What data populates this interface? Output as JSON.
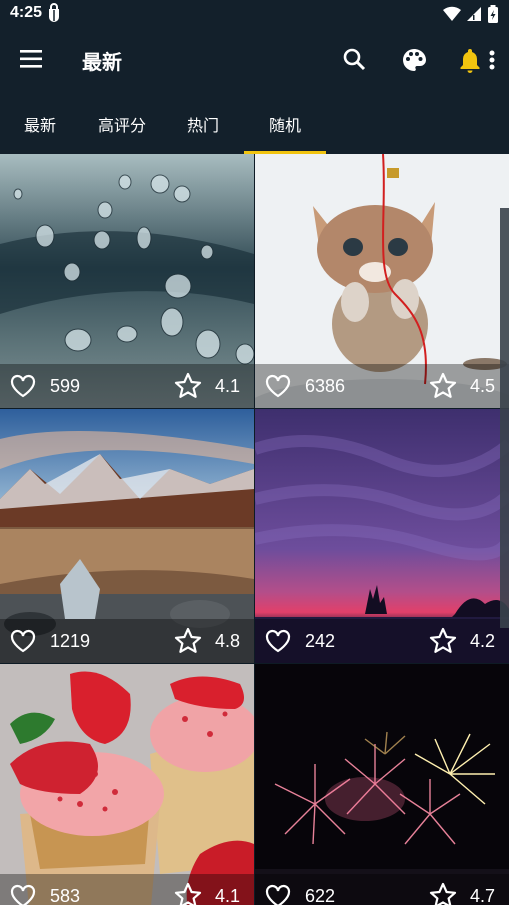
{
  "statusbar": {
    "time": "4:25"
  },
  "appbar": {
    "title": "最新"
  },
  "tabs": [
    {
      "label": "最新"
    },
    {
      "label": "高评分"
    },
    {
      "label": "热门"
    },
    {
      "label": "随机"
    }
  ],
  "active_tab": 3,
  "cards": [
    {
      "subject": "water drops",
      "likes": "599",
      "rating": "4.1"
    },
    {
      "subject": "kitten",
      "likes": "6386",
      "rating": "4.5"
    },
    {
      "subject": "mountain lake",
      "likes": "1219",
      "rating": "4.8"
    },
    {
      "subject": "purple sky",
      "likes": "242",
      "rating": "4.2"
    },
    {
      "subject": "cupcakes",
      "likes": "583",
      "rating": "4.1"
    },
    {
      "subject": "fireworks",
      "likes": "622",
      "rating": "4.7"
    }
  ],
  "colors": {
    "appbar": "#13202b",
    "accent": "#f1c40f"
  }
}
